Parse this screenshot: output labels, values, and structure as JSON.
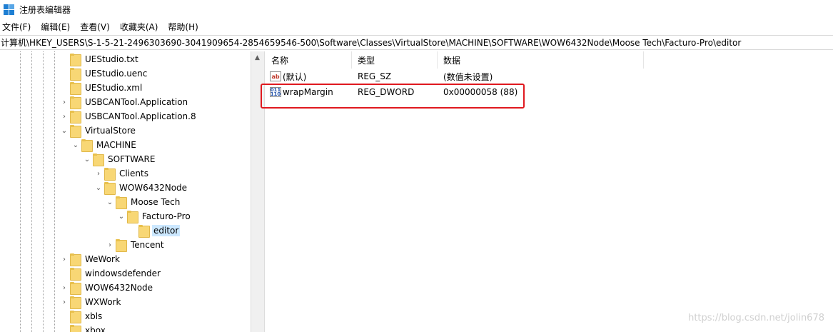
{
  "window": {
    "title": "注册表编辑器",
    "icon": "regedit-icon"
  },
  "menu": [
    "文件(F)",
    "编辑(E)",
    "查看(V)",
    "收藏夹(A)",
    "帮助(H)"
  ],
  "address": "计算机\\HKEY_USERS\\S-1-5-21-2496303690-3041909654-2854659546-500\\Software\\Classes\\VirtualStore\\MACHINE\\SOFTWARE\\WOW6432Node\\Moose Tech\\Facturo-Pro\\editor",
  "tree": [
    {
      "label": "UEStudio.txt",
      "expander": ""
    },
    {
      "label": "UEStudio.uenc",
      "expander": ""
    },
    {
      "label": "UEStudio.xml",
      "expander": ""
    },
    {
      "label": "USBCANTool.Application",
      "expander": "›"
    },
    {
      "label": "USBCANTool.Application.8",
      "expander": "›"
    },
    {
      "label": "VirtualStore",
      "expander": "⌄"
    },
    {
      "label": "MACHINE",
      "expander": "⌄"
    },
    {
      "label": "SOFTWARE",
      "expander": "⌄"
    },
    {
      "label": "Clients",
      "expander": "›"
    },
    {
      "label": "WOW6432Node",
      "expander": "⌄"
    },
    {
      "label": "Moose Tech",
      "expander": "⌄"
    },
    {
      "label": "Facturo-Pro",
      "expander": "⌄"
    },
    {
      "label": "editor",
      "expander": "",
      "selected": true
    },
    {
      "label": "Tencent",
      "expander": "›"
    },
    {
      "label": "WeWork",
      "expander": "›"
    },
    {
      "label": "windowsdefender",
      "expander": ""
    },
    {
      "label": "WOW6432Node",
      "expander": "›"
    },
    {
      "label": "WXWork",
      "expander": "›"
    },
    {
      "label": "xbls",
      "expander": ""
    },
    {
      "label": "xbox",
      "expander": ""
    }
  ],
  "list": {
    "headers": {
      "name": "名称",
      "type": "类型",
      "data": "数据"
    },
    "rows": [
      {
        "icon": "ab",
        "name": "(默认)",
        "type": "REG_SZ",
        "data": "(数值未设置)"
      },
      {
        "icon": "bin",
        "name": "wrapMargin",
        "type": "REG_DWORD",
        "data": "0x00000058 (88)"
      }
    ]
  },
  "highlight_color": "#e0191f",
  "watermark": "https://blog.csdn.net/jolin678"
}
